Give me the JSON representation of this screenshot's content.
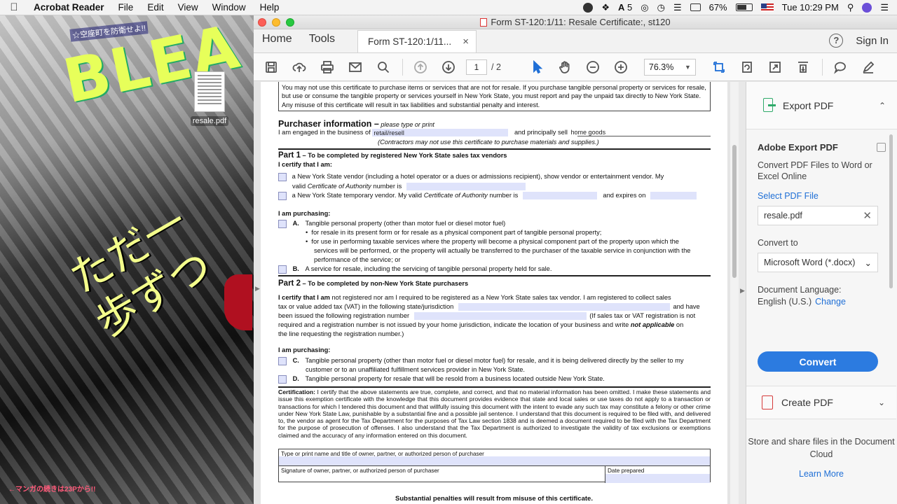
{
  "menubar": {
    "app_name": "Acrobat Reader",
    "items": [
      "File",
      "Edit",
      "View",
      "Window",
      "Help"
    ],
    "adobe_badge": "5",
    "battery": "67%",
    "clock": "Tue 10:29 PM"
  },
  "desktop": {
    "file_name": "resale.pdf",
    "wall_title": "BLEA",
    "wall_jp_big": "ただ一歩ずつ",
    "wall_jp_top": "☆空座町を防衛せよ!!",
    "wall_jp_bottom": "←マンガの続きは23Pから!!"
  },
  "window": {
    "title": "Form ST-120:1/11: Resale Certificate:, st120",
    "nav_home": "Home",
    "nav_tools": "Tools",
    "doc_tab": "Form ST-120:1/11...",
    "sign_in": "Sign In",
    "help": "?"
  },
  "toolbar": {
    "page_current": "1",
    "page_total": "/ 2",
    "zoom": "76.3%"
  },
  "document": {
    "intro": "You may not use this certificate to purchase items or services that are not for resale. If you purchase tangible personal property or services for resale, but use or consume the tangible property or services yourself in New York State, you must report and pay the unpaid tax directly to New York State. Any misuse of this certificate will result in tax liabilities and substantial penalty and interest.",
    "purchaser_heading": "Purchaser information –",
    "purchaser_sub": "please type or print",
    "engaged_label": "I am engaged in the business of",
    "engaged_value": "retail/resell",
    "principally_label": "and principally sell",
    "principally_value": "home goods",
    "contractors_note": "(Contractors may not use this certificate to purchase materials and supplies.)",
    "part1_title": "Part 1",
    "part1_desc": " – To be completed by registered New York State sales tax vendors",
    "certify": "I certify that I am:",
    "p1_opt1_line1": "a New York State vendor (including a hotel operator or a dues or admissions recipient), show vendor or entertainment vendor. My",
    "p1_opt1_line2a": "valid ",
    "p1_opt1_line2b": "Certificate of Authority",
    "p1_opt1_line2c": " number is",
    "p1_opt2a": "a New York State temporary vendor. My valid ",
    "p1_opt2b": "Certificate of Authority",
    "p1_opt2c": " number is",
    "expires_on": "and expires on",
    "purchasing": "I am purchasing:",
    "opt_a_letter": "A.",
    "opt_a": "Tangible personal property (other than motor fuel or diesel motor fuel)",
    "bullet1": "for resale in its present form or for resale as a physical component part of tangible personal property;",
    "bullet2_l1": "for use in performing taxable services where the property will become a physical component part of the property upon which the",
    "bullet2_l2": "services will be performed, or the property will actually be transferred to the purchaser of the taxable service in conjunction with the",
    "bullet2_l3": "performance of the service; or",
    "opt_b_letter": "B.",
    "opt_b": "A service for resale, including the servicing of tangible personal property held for sale.",
    "part2_title": "Part 2",
    "part2_desc": " – To be completed by non-New York State purchasers",
    "p2_l1a": "I certify that I am",
    "p2_l1b": " not registered nor am I required to be registered as a New York State sales tax vendor. I am registered to collect sales",
    "p2_l2a": "tax or value added tax (VAT) in the following state/jurisdiction",
    "p2_l2b": "and have",
    "p2_l3a": "been issued the following registration number",
    "p2_l3b": "(If sales tax or VAT registration is not",
    "p2_l4a": "required and a registration number is not issued by your home jurisdiction, indicate the location of your business and write ",
    "p2_l4b": "not applicable",
    "p2_l4c": " on",
    "p2_l5": "the line requesting the registration number.)",
    "purchasing2": "I am purchasing:",
    "opt_c_letter": "C.",
    "opt_c_l1": "Tangible personal property (other than motor fuel or diesel motor fuel) for resale, and it is being delivered directly by the seller to my",
    "opt_c_l2": "customer or to an unaffiliated fulfillment services provider in New York State.",
    "opt_d_letter": "D.",
    "opt_d": "Tangible personal property for resale that will be resold from a business located outside New York State.",
    "cert_label": "Certification:",
    "cert_text": " I certify that the above statements are true, complete, and correct, and that no material information has been omitted. I make these statements and issue this exemption certificate with the knowledge that this document provides evidence that state and local sales or use taxes do not apply to a transaction or transactions for which I tendered this document and that willfully issuing this document with the intent to evade any such tax may constitute a felony or other crime under New York State Law, punishable by a substantial fine and a possible jail sentence. I understand that this document is required to be filed with, and delivered to, the vendor as agent for the Tax Department for the purposes of Tax Law section 1838 and is deemed a document required to be filed with the Tax Department for the purpose of prosecution of offenses. I also understand that the Tax Department is authorized to investigate the validity of tax exclusions or exemptions claimed and the accuracy of any information entered on this document.",
    "sig_row1": "Type or print name and title of owner, partner, or authorized person of purchaser",
    "sig_row2a": "Signature of owner, partner, or authorized person of purchaser",
    "sig_row2b": "Date prepared",
    "penalties": "Substantial penalties will result from misuse of this certificate."
  },
  "right_panel": {
    "export_header": "Export PDF",
    "title": "Adobe Export PDF",
    "desc": "Convert PDF Files to Word or Excel Online",
    "select_file": "Select PDF File",
    "file_value": "resale.pdf",
    "convert_to": "Convert to",
    "format": "Microsoft Word (*.docx)",
    "doc_lang_label": "Document Language:",
    "doc_lang_value": "English (U.S.)",
    "change": "Change",
    "convert_btn": "Convert",
    "create_header": "Create PDF",
    "store_text": "Store and share files in the Document Cloud",
    "learn_more": "Learn More"
  },
  "colors": {
    "accent": "#2c7be0",
    "form_field": "#dfe3fb",
    "export_green": "#2faa6a",
    "create_red": "#d53a3a"
  }
}
